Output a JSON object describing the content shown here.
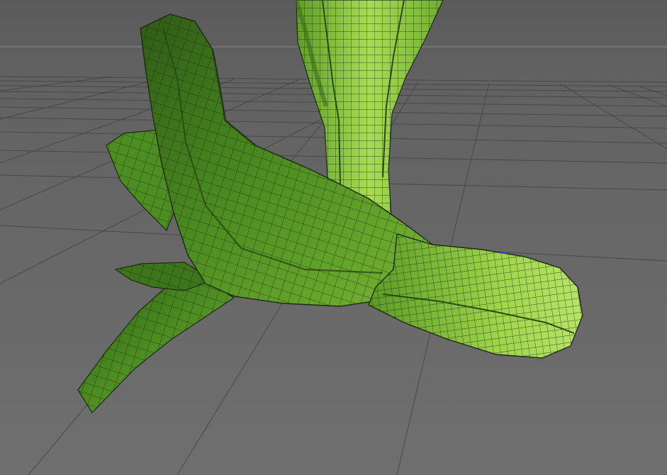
{
  "viewport": {
    "background_top": "#5a5a5a",
    "background_bottom": "#6e6e6e",
    "horizon_color": "#7d7d7d",
    "grid_color": "#3f3f3f",
    "wire_color": "#1e2a12",
    "mesh_colors": {
      "dark": "#2f5a16",
      "mid": "#4f8f22",
      "light": "#8fcc3c",
      "highlight": "#b9e86a"
    },
    "objects": [
      "bok-choy-base-leaf-mesh",
      "bok-choy-stem-mesh"
    ]
  }
}
